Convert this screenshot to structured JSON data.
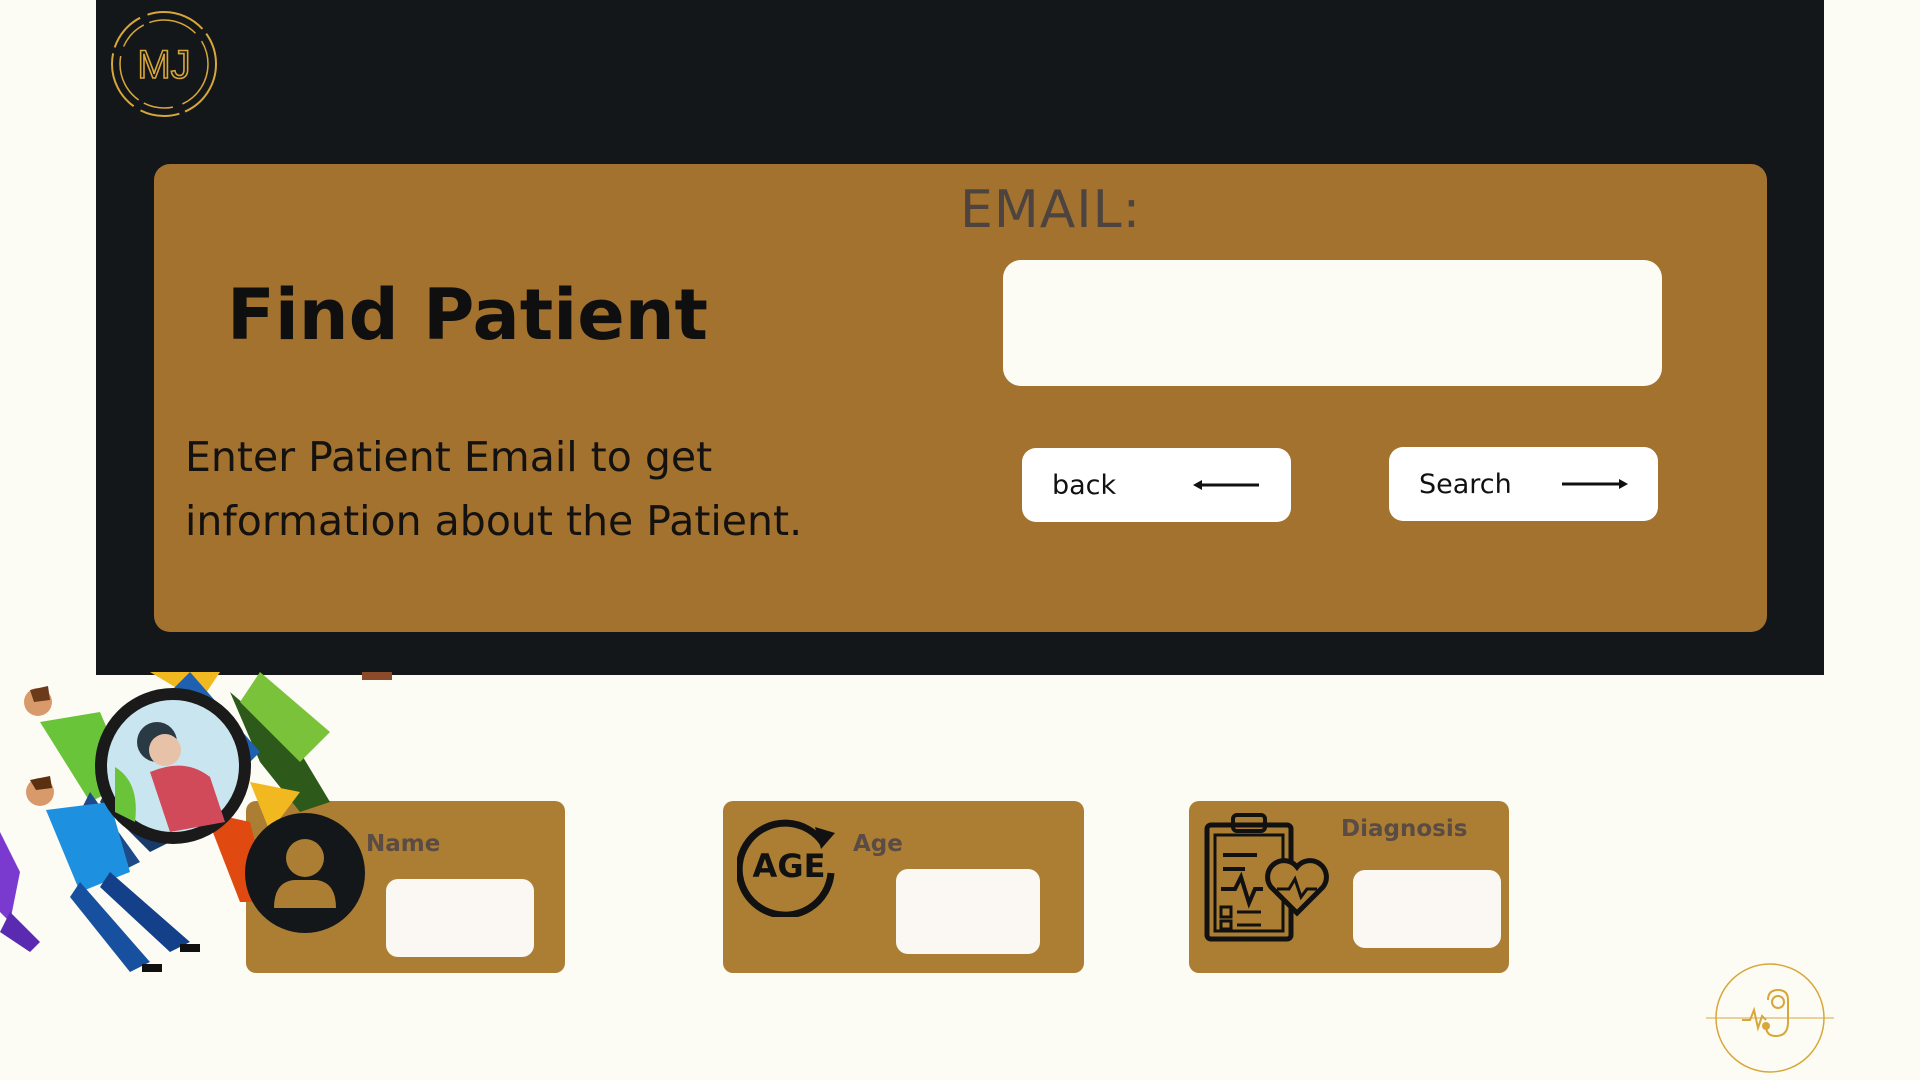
{
  "logo": {
    "text": "MJ",
    "icon": "mj-monogram-icon"
  },
  "hero": {
    "title": "Find Patient",
    "description": "Enter Patient Email to get information about the Patient."
  },
  "email": {
    "label": "EMAIL:",
    "value": "",
    "placeholder": ""
  },
  "buttons": {
    "back": {
      "label": "back",
      "icon": "arrow-left-icon"
    },
    "search": {
      "label": "Search",
      "icon": "arrow-right-icon"
    }
  },
  "cards": {
    "name": {
      "label": "Name",
      "icon": "user-icon",
      "value": ""
    },
    "age": {
      "label": "Age",
      "icon": "age-cycle-icon",
      "icon_text": "AGE",
      "value": ""
    },
    "diagnosis": {
      "label": "Diagnosis",
      "icon": "clipboard-heart-icon",
      "value": ""
    }
  },
  "illustration": {
    "icon": "people-magnifier-illustration"
  },
  "footer_logo": {
    "icon": "stethoscope-heartbeat-logo"
  },
  "colors": {
    "page_background": "#fdfcf4",
    "top_band": "#13171a",
    "panel": "#a4722f",
    "card": "#ab7e33",
    "gold": "#d8a63a"
  }
}
